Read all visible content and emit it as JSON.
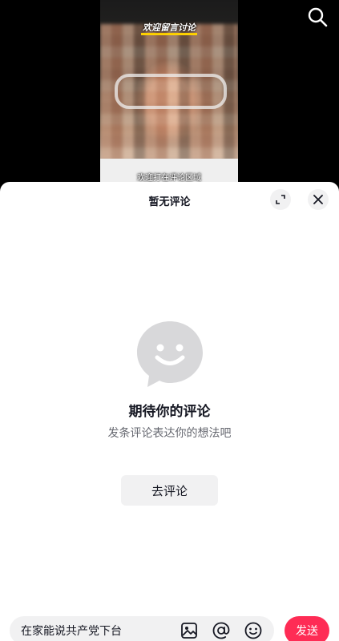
{
  "video": {
    "top_text": "欢迎留言讨论",
    "caption": "欢迎打在评论区域"
  },
  "sheet": {
    "title": "暂无评论",
    "empty_title": "期待你的评论",
    "empty_subtitle": "发条评论表达你的想法吧",
    "go_comment_label": "去评论"
  },
  "input": {
    "value": "在家能说共产党下台",
    "send_label": "发送"
  },
  "icons": {
    "search": "search-icon",
    "expand": "expand-icon",
    "close": "close-icon",
    "empty": "smile-chat-bubble-icon",
    "image": "image-icon",
    "mention": "at-sign-icon",
    "emoji": "emoji-icon"
  },
  "colors": {
    "accent": "#fe2c55",
    "muted_bg": "#f1f1f2",
    "empty_icon": "#d8d8da"
  }
}
